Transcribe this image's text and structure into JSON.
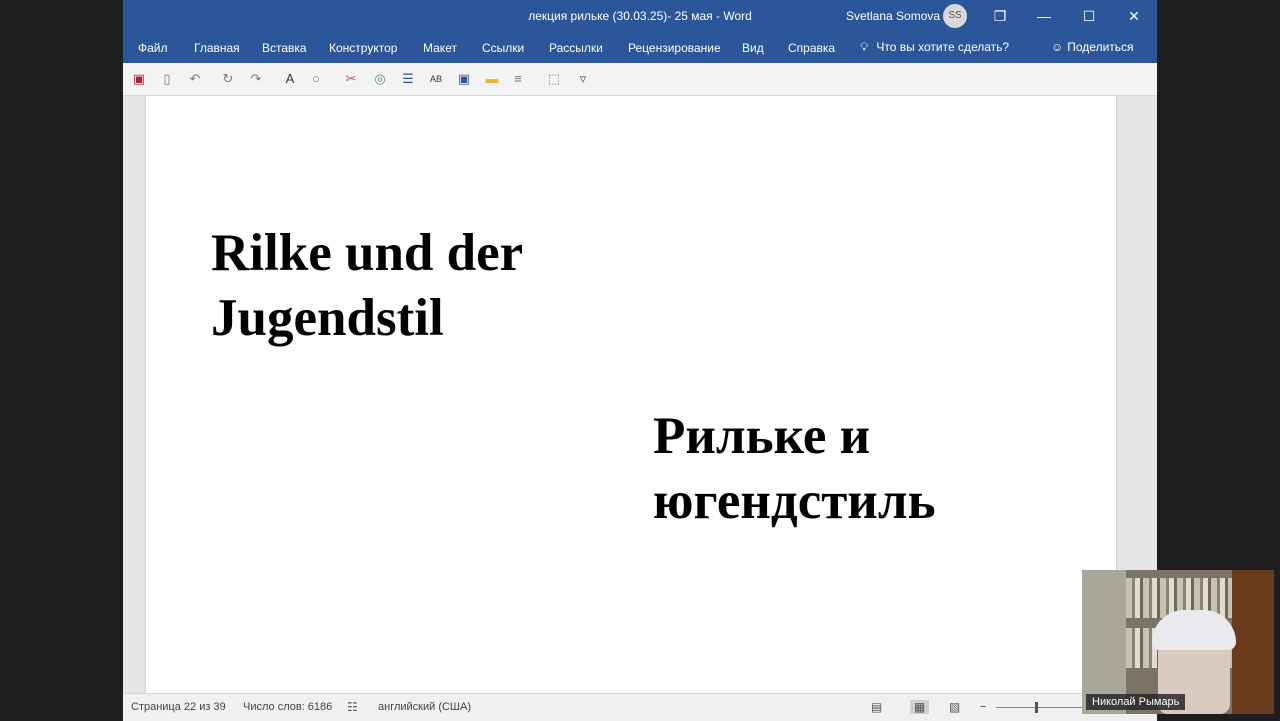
{
  "titlebar": {
    "doc_title": "лекция рильке (30.03.25)- 25 мая  -  Word",
    "user_name": "Svetlana Somova",
    "avatar_initials": "SS",
    "restore_icon": "ribbon-display-options-icon",
    "minimize_icon": "minimize-icon",
    "maximize_icon": "maximize-icon",
    "close_icon": "close-icon"
  },
  "ribbon": {
    "tabs": [
      "Файл",
      "Главная",
      "Вставка",
      "Конструктор",
      "Макет",
      "Ссылки",
      "Рассылки",
      "Рецензирование",
      "Вид",
      "Справка"
    ],
    "tell_me": "Что вы хотите сделать?",
    "share": "Поделиться",
    "accent": "#2b579a"
  },
  "qat": {
    "icons": [
      "save-icon",
      "new-document-icon",
      "undo-icon",
      "repeat-icon",
      "redo-icon",
      "font-color-icon",
      "shape-icon",
      "clear-format-icon",
      "circle-icon",
      "list-icon",
      "spelling-icon",
      "save-as-icon",
      "open-folder-icon",
      "align-icon",
      "select-icon",
      "customize-icon"
    ]
  },
  "document": {
    "heading_de_line1": "Rilke und der",
    "heading_de_line2": "Jugendstil",
    "heading_ru_line1": "Рильке и",
    "heading_ru_line2": "югендстиль"
  },
  "statusbar": {
    "page": "Страница 22 из 39",
    "words": "Число слов: 6186",
    "language": "английский (США)",
    "zoom_minus": "−"
  },
  "video": {
    "participant_name": "Николай Рымарь"
  }
}
